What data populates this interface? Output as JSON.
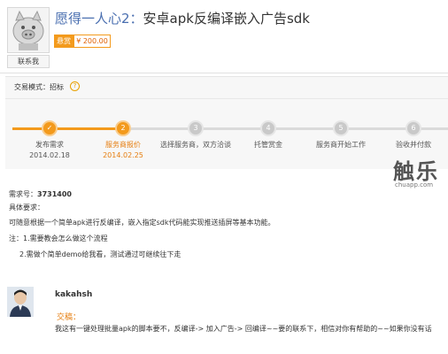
{
  "header": {
    "title_name": "愿得一人心2：",
    "title_text": "安卓apk反编译嵌入广告sdk",
    "contact_label": "联系我",
    "bounty_label": "悬赏",
    "bounty_amount": "¥ 200.00"
  },
  "trade": {
    "mode_label": "交易模式：",
    "mode_value": "招标",
    "help_icon": "help-icon",
    "steps": [
      {
        "num": "✓",
        "label": "发布需求",
        "date": "2014.02.18",
        "state": "done"
      },
      {
        "num": "2",
        "label": "服务商报价",
        "date": "2014.02.25",
        "state": "current"
      },
      {
        "num": "3",
        "label": "选择服务商，双方洽谈",
        "date": "",
        "state": "todo"
      },
      {
        "num": "4",
        "label": "托管赏金",
        "date": "",
        "state": "todo"
      },
      {
        "num": "5",
        "label": "服务商开始工作",
        "date": "",
        "state": "todo"
      },
      {
        "num": "6",
        "label": "验收并付款",
        "date": "",
        "state": "todo"
      }
    ]
  },
  "watermark": {
    "big": "触乐",
    "small": "chuapp.com"
  },
  "requirement": {
    "id_label": "需求号：",
    "id_value": "3731400",
    "detail_label": "具体要求：",
    "line1": "可随意根据一个简单apk进行反编译，嵌入指定sdk代码能实现推送插屏等基本功能。",
    "note1": "注：1.需要教会怎么做这个流程",
    "note2": "2.需做个简单demo给我看，测试通过可继续往下走"
  },
  "bid": {
    "username": "kakahsh",
    "bid_label": "交稿：",
    "text": "我这有一键处理批量apk的脚本要不，反编译-> 加入广告-> 回编译~~要的联系下，相信对你有帮助的~~如果你没有话"
  },
  "colors": {
    "accent": "#f39a1c",
    "link": "#4a6fb0"
  }
}
